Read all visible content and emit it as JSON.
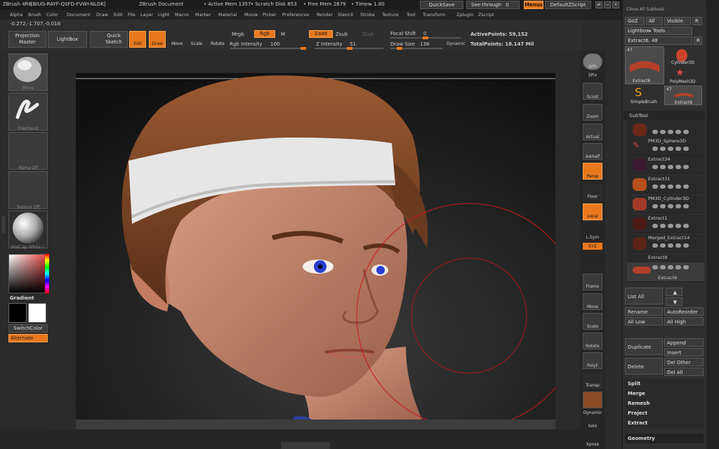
{
  "titlebar": {
    "app": "ZBrush 4R6",
    "serial": "[BIUG-RAYF-QSFD-FVWI-NLDK]",
    "doc": "ZBrush Document",
    "active_mem": "• Active Mem 1357",
    "scratch": "• Scratch Disk 853",
    "free_mem": "• Free Mem 2679",
    "timer": "• Timer▸ 1.80",
    "quicksave": "QuickSave",
    "seethrough": "See-through",
    "seethrough_val": "0",
    "menus": "Menus",
    "zscript": "DefaultZScript"
  },
  "menu": [
    "Alpha",
    "Brush",
    "Color",
    "Document",
    "Draw",
    "Edit",
    "File",
    "Layer",
    "Light",
    "Macro",
    "Marker",
    "Material",
    "Movie",
    "Picker",
    "Preferences",
    "Render",
    "Stencil",
    "Stroke",
    "Texture",
    "Tool",
    "Transform",
    "Zplugin",
    "Zscript"
  ],
  "coords": "-0.272,-1.707,-0.016",
  "toolbar": {
    "projection_master": "Projection Master",
    "lightbox": "LightBox",
    "quick_sketch": "Quick Sketch",
    "edit": "Edit",
    "draw": "Draw",
    "move": "Move",
    "scale": "Scale",
    "rotate": "Rotate",
    "mrgb": "Mrgb",
    "rgb": "Rgb",
    "m": "M",
    "zadd": "Zadd",
    "zsub": "Zsub",
    "zcut": "Zcut",
    "focal_shift_label": "Focal Shift",
    "focal_shift_val": "0",
    "rgb_intensity_label": "Rgb Intensity",
    "rgb_intensity_val": "100",
    "z_intensity_label": "Z Intensity",
    "z_intensity_val": "51",
    "draw_size_label": "Draw Size",
    "draw_size_val": "138",
    "dynamic": "Dynamic",
    "active_points": "ActivePoints: 59,152",
    "total_points": "TotalPoints: 18.147 Mil",
    "rgb_intensity_fraction": 1.0,
    "z_intensity_fraction": 0.51,
    "focal_shift_fraction": 0.5,
    "draw_size_fraction": 0.14
  },
  "left": {
    "brush": "Move",
    "stroke": "FreeHand",
    "alpha": "Alpha Off",
    "texture": "Texture Off",
    "matcap": "MatCap White C",
    "gradient": "Gradient",
    "switchcolor": "SwitchColor",
    "alternate": "Alternate"
  },
  "shelf": [
    "BPR",
    "SPix",
    "Scroll",
    "Zoom",
    "Actual",
    "AAHalf",
    "Persp",
    "Floor",
    "Local",
    "L.Sym",
    "XYZ",
    "Frame",
    "Move",
    "Scale",
    "Rotate",
    "PolyF",
    "Transp",
    "Dynamic",
    "Solo",
    "Xpose"
  ],
  "tray": {
    "clone_all": "Clone All Subtools",
    "goz": "GoZ",
    "all": "All",
    "visible": "Visible",
    "r": "R",
    "lightbox_tools": "Lightbox▸ Tools",
    "current_tool": "Extract6. 48",
    "r2": "R",
    "tools": [
      {
        "name": "Extract6",
        "count": "47"
      },
      {
        "name": "Cylinder3D",
        "count": ""
      },
      {
        "name": "PolyMesh3D",
        "count": ""
      },
      {
        "name": "SimpleBrush",
        "count": ""
      },
      {
        "name": "Extract6",
        "count": "47"
      }
    ],
    "subtool_title": "SubTool",
    "subtools": [
      "",
      "PM3D_Sphere3D",
      "Extract34",
      "Extract31",
      "PM3D_Cylinder3D",
      "Extract1",
      "Merged_Extract14",
      "Extract9",
      "Extract6"
    ],
    "list_all": "List All",
    "rename": "Rename",
    "autoreorder": "AutoReorder",
    "all_low": "All Low",
    "all_high": "All High",
    "duplicate": "Duplicate",
    "append": "Append",
    "insert": "Insert",
    "delete": "Delete",
    "del_other": "Del Other",
    "del_all": "Del All",
    "split": "Split",
    "merge": "Merge",
    "remesh": "Remesh",
    "project": "Project",
    "extract": "Extract",
    "geometry": "Geometry"
  },
  "colors": {
    "accent": "#e8781e",
    "panel": "#2e2e2e",
    "canvas": "#141414",
    "skin": "#c98468",
    "hair": "#7a4626",
    "headband": "#e8e8e8",
    "eye": "#2a3fd1",
    "brush_circle": "#c81818"
  }
}
